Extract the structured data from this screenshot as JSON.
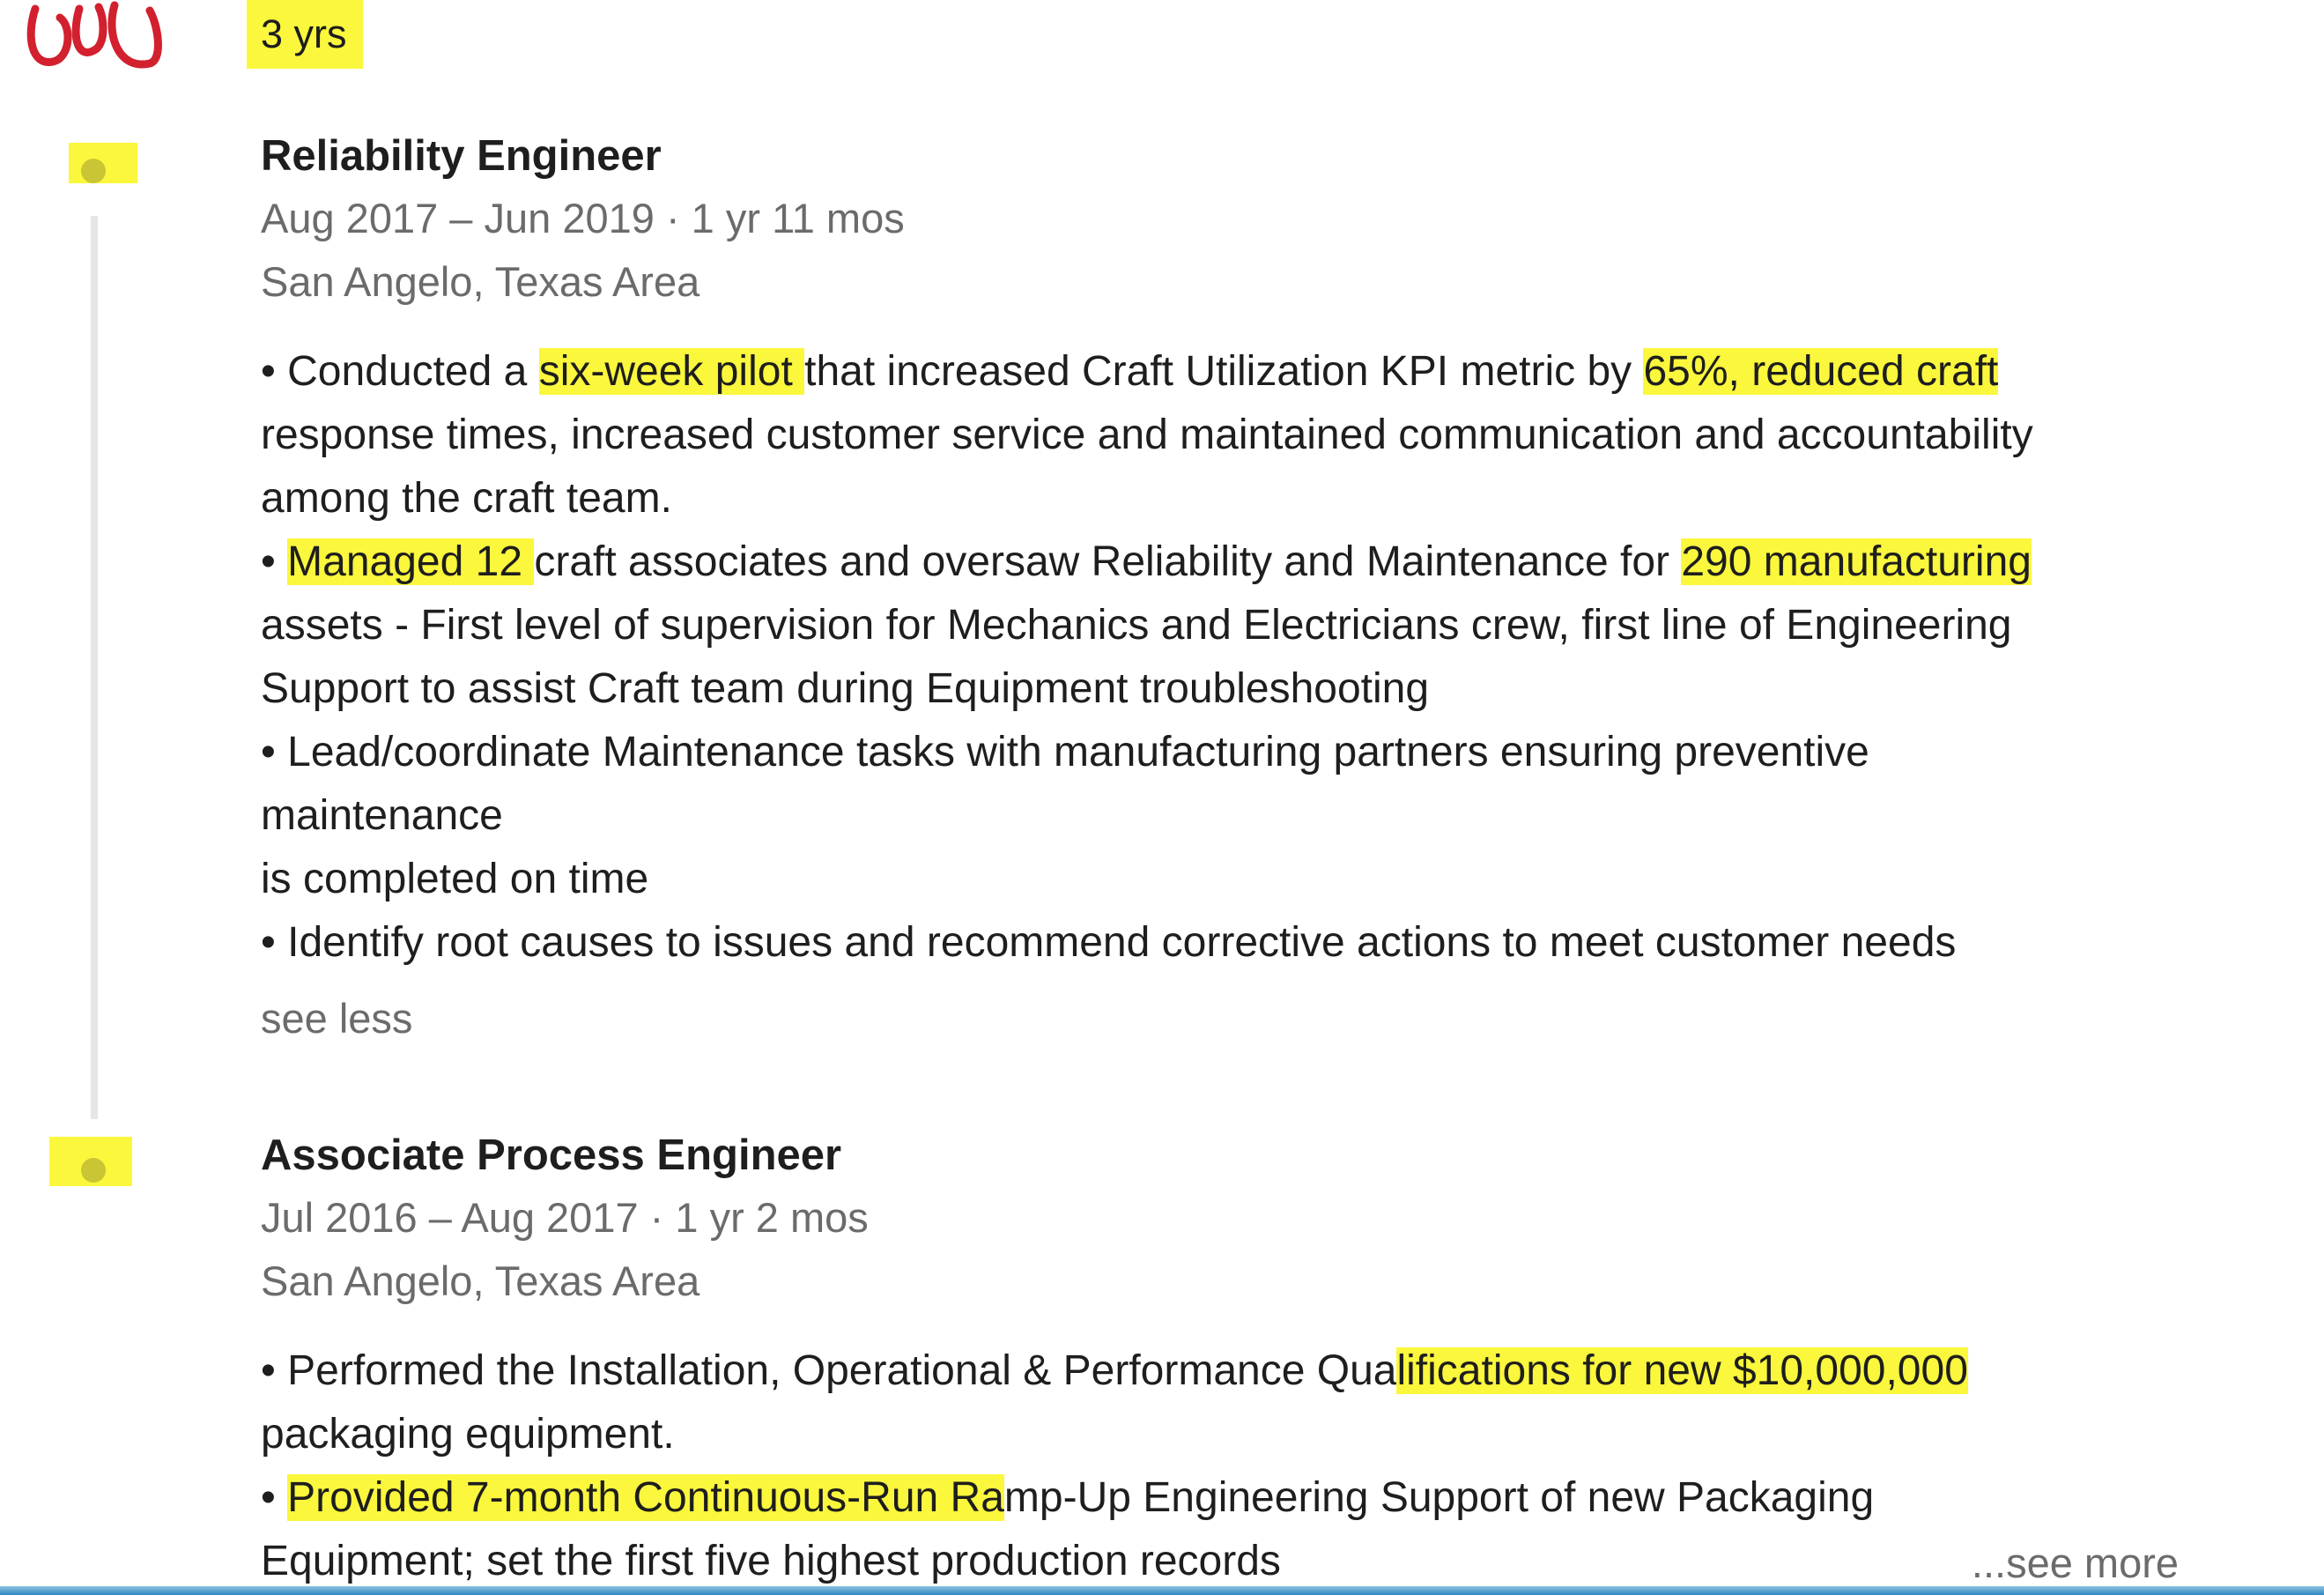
{
  "tenure": {
    "duration": "3 yrs"
  },
  "logo": {
    "icon": "company-logo-icon",
    "color": "#d2202f"
  },
  "highlight_color": "#faf73d",
  "positions": [
    {
      "title": "Reliability Engineer",
      "dates": "Aug 2017 – Jun 2019 · 1 yr 11 mos",
      "location": "San Angelo, Texas Area",
      "lines": [
        [
          {
            "t": "• Conducted a ",
            "h": false
          },
          {
            "t": "six-week pilot ",
            "h": true
          },
          {
            "t": "that increased Craft Utilization KPI metric by ",
            "h": false
          },
          {
            "t": "65%, reduced craft ",
            "h": true
          }
        ],
        [
          {
            "t": "response times, increased customer service and maintained communication and accountability",
            "h": false
          }
        ],
        [
          {
            "t": "among the craft team.",
            "h": false
          }
        ],
        [
          {
            "t": "• ",
            "h": false
          },
          {
            "t": "Managed 12 ",
            "h": true
          },
          {
            "t": "craft associates and oversaw Reliability and Maintenance for ",
            "h": false
          },
          {
            "t": "290 manufacturing",
            "h": true
          }
        ],
        [
          {
            "t": "assets - First level of supervision for Mechanics and Electricians crew, first line of Engineering",
            "h": false
          }
        ],
        [
          {
            "t": "Support to assist Craft team during Equipment troubleshooting",
            "h": false
          }
        ],
        [
          {
            "t": "• Lead/coordinate Maintenance tasks with manufacturing partners ensuring preventive",
            "h": false
          }
        ],
        [
          {
            "t": "maintenance",
            "h": false
          }
        ],
        [
          {
            "t": "is completed on time",
            "h": false
          }
        ],
        [
          {
            "t": "• Identify root causes to issues and recommend corrective actions to meet customer needs",
            "h": false
          }
        ]
      ],
      "toggle": "see less"
    },
    {
      "title": "Associate Process Engineer",
      "dates": "Jul 2016 – Aug 2017 · 1 yr 2 mos",
      "location": "San Angelo, Texas Area",
      "lines": [
        [
          {
            "t": "• Performed the Installation, Operational & Performance Qua",
            "h": false
          },
          {
            "t": "lifications for new $10,000,000 ",
            "h": true
          }
        ],
        [
          {
            "t": "packaging equipment.",
            "h": false
          }
        ],
        [
          {
            "t": "• ",
            "h": false
          },
          {
            "t": "Provided 7-month Continuous-Run Ra",
            "h": true
          },
          {
            "t": "mp-Up Engineering Support of new Packaging",
            "h": false
          }
        ],
        [
          {
            "t": "Equipment; set the first five highest production records",
            "h": false
          }
        ]
      ],
      "toggle": "...see more"
    }
  ]
}
